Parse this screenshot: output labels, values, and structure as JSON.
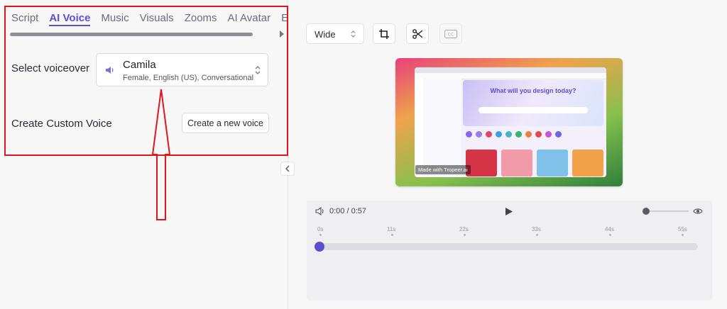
{
  "tabs": [
    {
      "label": "Script",
      "active": false
    },
    {
      "label": "AI Voice",
      "active": true
    },
    {
      "label": "Music",
      "active": false
    },
    {
      "label": "Visuals",
      "active": false
    },
    {
      "label": "Zooms",
      "active": false
    },
    {
      "label": "AI Avatar",
      "active": false
    },
    {
      "label": "Elemen",
      "active": false
    }
  ],
  "voiceover": {
    "label": "Select voiceover",
    "selected_name": "Camila",
    "selected_desc": "Female, English (US), Conversational"
  },
  "custom_voice": {
    "label": "Create Custom Voice",
    "button_label": "Create a new voice"
  },
  "toolbar": {
    "aspect_value": "Wide",
    "icons": [
      "crop-icon",
      "scissors-icon",
      "cc-icon"
    ]
  },
  "preview": {
    "hero_title": "What will you design today?",
    "watermark": "Made with Tropeer.ai"
  },
  "player": {
    "time_current": "0:00",
    "time_separator": "/",
    "time_total": "0:57",
    "ticks": [
      "0s",
      "11s",
      "22s",
      "33s",
      "44s",
      "55s"
    ],
    "progress": 0
  },
  "colors": {
    "accent": "#5a4fcf",
    "annotation": "#e0161c"
  }
}
